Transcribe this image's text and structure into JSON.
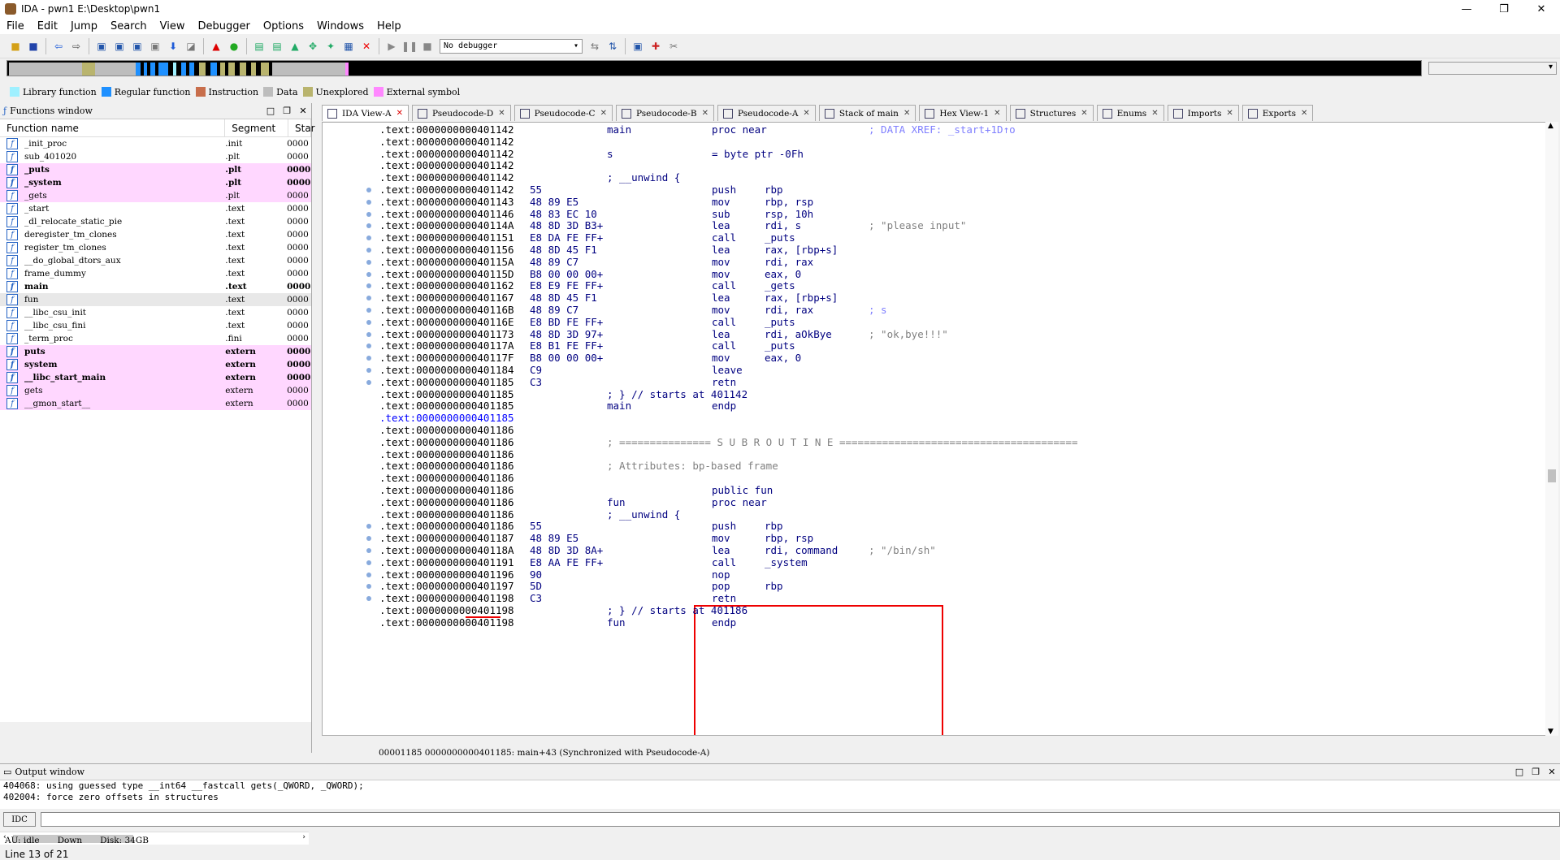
{
  "window": {
    "title": "IDA - pwn1 E:\\Desktop\\pwn1",
    "minimize": "—",
    "maximize": "❐",
    "close": "✕"
  },
  "menu": [
    "File",
    "Edit",
    "Jump",
    "Search",
    "View",
    "Debugger",
    "Options",
    "Windows",
    "Help"
  ],
  "toolbar": {
    "debugger_select": "No debugger"
  },
  "legend": [
    {
      "label": "Library function",
      "color": "#9ff0ff"
    },
    {
      "label": "Regular function",
      "color": "#1e90ff"
    },
    {
      "label": "Instruction",
      "color": "#c86e4b"
    },
    {
      "label": "Data",
      "color": "#bdbdbd"
    },
    {
      "label": "Unexplored",
      "color": "#b9b46e"
    },
    {
      "label": "External symbol",
      "color": "#ff88ff"
    }
  ],
  "functions_window": {
    "title": "Functions window",
    "columns": [
      "Function name",
      "Segment",
      "Star"
    ],
    "rows": [
      {
        "name": "_init_proc",
        "segment": ".init",
        "start": "0000",
        "style": ""
      },
      {
        "name": "sub_401020",
        "segment": ".plt",
        "start": "0000",
        "style": ""
      },
      {
        "name": "_puts",
        "segment": ".plt",
        "start": "0000",
        "style": "pink bold"
      },
      {
        "name": "_system",
        "segment": ".plt",
        "start": "0000",
        "style": "pink bold"
      },
      {
        "name": "_gets",
        "segment": ".plt",
        "start": "0000",
        "style": "pink"
      },
      {
        "name": "_start",
        "segment": ".text",
        "start": "0000",
        "style": ""
      },
      {
        "name": "_dl_relocate_static_pie",
        "segment": ".text",
        "start": "0000",
        "style": ""
      },
      {
        "name": "deregister_tm_clones",
        "segment": ".text",
        "start": "0000",
        "style": ""
      },
      {
        "name": "register_tm_clones",
        "segment": ".text",
        "start": "0000",
        "style": ""
      },
      {
        "name": "__do_global_dtors_aux",
        "segment": ".text",
        "start": "0000",
        "style": ""
      },
      {
        "name": "frame_dummy",
        "segment": ".text",
        "start": "0000",
        "style": ""
      },
      {
        "name": "main",
        "segment": ".text",
        "start": "0000",
        "style": "bold"
      },
      {
        "name": "fun",
        "segment": ".text",
        "start": "0000",
        "style": "sel"
      },
      {
        "name": "__libc_csu_init",
        "segment": ".text",
        "start": "0000",
        "style": ""
      },
      {
        "name": "__libc_csu_fini",
        "segment": ".text",
        "start": "0000",
        "style": ""
      },
      {
        "name": "_term_proc",
        "segment": ".fini",
        "start": "0000",
        "style": ""
      },
      {
        "name": "puts",
        "segment": "extern",
        "start": "0000",
        "style": "pink bold"
      },
      {
        "name": "system",
        "segment": "extern",
        "start": "0000",
        "style": "pink bold"
      },
      {
        "name": "__libc_start_main",
        "segment": "extern",
        "start": "0000",
        "style": "pink bold"
      },
      {
        "name": "gets",
        "segment": "extern",
        "start": "0000",
        "style": "pink"
      },
      {
        "name": "__gmon_start__",
        "segment": "extern",
        "start": "0000",
        "style": "pink"
      }
    ],
    "line_info": "Line 13 of 21"
  },
  "tabs": [
    {
      "label": "IDA View-A",
      "active": true
    },
    {
      "label": "Pseudocode-D",
      "active": false
    },
    {
      "label": "Pseudocode-C",
      "active": false
    },
    {
      "label": "Pseudocode-B",
      "active": false
    },
    {
      "label": "Pseudocode-A",
      "active": false
    },
    {
      "label": "Stack of main",
      "active": false
    },
    {
      "label": "Hex View-1",
      "active": false
    },
    {
      "label": "Structures",
      "active": false
    },
    {
      "label": "Enums",
      "active": false
    },
    {
      "label": "Imports",
      "active": false
    },
    {
      "label": "Exports",
      "active": false
    }
  ],
  "disasm": [
    {
      "addr": ".text:0000000000401142",
      "bytes": "",
      "label": "main",
      "mn": "proc near",
      "op": "",
      "cm": "; DATA XREF: _start+1D↑o",
      "cmblue": true
    },
    {
      "addr": ".text:0000000000401142",
      "bytes": "",
      "label": "",
      "mn": "",
      "op": "",
      "cm": ""
    },
    {
      "addr": ".text:0000000000401142",
      "bytes": "",
      "label": "s",
      "mn": "= byte ptr -0Fh",
      "op": "",
      "cm": ""
    },
    {
      "addr": ".text:0000000000401142",
      "bytes": "",
      "label": "",
      "mn": "",
      "op": "",
      "cm": ""
    },
    {
      "addr": ".text:0000000000401142",
      "bytes": "",
      "label": "; __unwind {",
      "mn": "",
      "op": "",
      "cm": ""
    },
    {
      "addr": ".text:0000000000401142",
      "bytes": "55",
      "label": "",
      "mn": "push",
      "op": "rbp",
      "cm": "",
      "dot": true
    },
    {
      "addr": ".text:0000000000401143",
      "bytes": "48 89 E5",
      "label": "",
      "mn": "mov",
      "op": "rbp, rsp",
      "cm": "",
      "dot": true
    },
    {
      "addr": ".text:0000000000401146",
      "bytes": "48 83 EC 10",
      "label": "",
      "mn": "sub",
      "op": "rsp, 10h",
      "cm": "",
      "dot": true
    },
    {
      "addr": ".text:000000000040114A",
      "bytes": "48 8D 3D B3+",
      "label": "",
      "mn": "lea",
      "op": "rdi, s",
      "cm": "; \"please input\"",
      "dot": true
    },
    {
      "addr": ".text:0000000000401151",
      "bytes": "E8 DA FE FF+",
      "label": "",
      "mn": "call",
      "op": "_puts",
      "cm": "",
      "dot": true
    },
    {
      "addr": ".text:0000000000401156",
      "bytes": "48 8D 45 F1",
      "label": "",
      "mn": "lea",
      "op": "rax, [rbp+s]",
      "cm": "",
      "dot": true
    },
    {
      "addr": ".text:000000000040115A",
      "bytes": "48 89 C7",
      "label": "",
      "mn": "mov",
      "op": "rdi, rax",
      "cm": "",
      "dot": true
    },
    {
      "addr": ".text:000000000040115D",
      "bytes": "B8 00 00 00+",
      "label": "",
      "mn": "mov",
      "op": "eax, 0",
      "cm": "",
      "dot": true
    },
    {
      "addr": ".text:0000000000401162",
      "bytes": "E8 E9 FE FF+",
      "label": "",
      "mn": "call",
      "op": "_gets",
      "cm": "",
      "dot": true
    },
    {
      "addr": ".text:0000000000401167",
      "bytes": "48 8D 45 F1",
      "label": "",
      "mn": "lea",
      "op": "rax, [rbp+s]",
      "cm": "",
      "dot": true
    },
    {
      "addr": ".text:000000000040116B",
      "bytes": "48 89 C7",
      "label": "",
      "mn": "mov",
      "op": "rdi, rax",
      "cm": "; s",
      "dot": true,
      "cmblue": true
    },
    {
      "addr": ".text:000000000040116E",
      "bytes": "E8 BD FE FF+",
      "label": "",
      "mn": "call",
      "op": "_puts",
      "cm": "",
      "dot": true
    },
    {
      "addr": ".text:0000000000401173",
      "bytes": "48 8D 3D 97+",
      "label": "",
      "mn": "lea",
      "op": "rdi, aOkBye",
      "cm": "; \"ok,bye!!!\"",
      "dot": true
    },
    {
      "addr": ".text:000000000040117A",
      "bytes": "E8 B1 FE FF+",
      "label": "",
      "mn": "call",
      "op": "_puts",
      "cm": "",
      "dot": true
    },
    {
      "addr": ".text:000000000040117F",
      "bytes": "B8 00 00 00+",
      "label": "",
      "mn": "mov",
      "op": "eax, 0",
      "cm": "",
      "dot": true
    },
    {
      "addr": ".text:0000000000401184",
      "bytes": "C9",
      "label": "",
      "mn": "leave",
      "op": "",
      "cm": "",
      "dot": true
    },
    {
      "addr": ".text:0000000000401185",
      "bytes": "C3",
      "label": "",
      "mn": "retn",
      "op": "",
      "cm": "",
      "dot": true
    },
    {
      "addr": ".text:0000000000401185",
      "bytes": "",
      "label": "; } // starts at 401142",
      "mn": "",
      "op": "",
      "cm": ""
    },
    {
      "addr": ".text:0000000000401185",
      "bytes": "",
      "label": "main",
      "mn": "endp",
      "op": "",
      "cm": ""
    },
    {
      "addr": ".text:0000000000401185",
      "bytes": "",
      "label": "",
      "mn": "",
      "op": "",
      "cm": "",
      "blue": true
    },
    {
      "addr": ".text:0000000000401186",
      "bytes": "",
      "label": "",
      "mn": "",
      "op": "",
      "cm": ""
    },
    {
      "addr": ".text:0000000000401186",
      "bytes": "",
      "label": "; =============== S U B R O U T I N E =======================================",
      "mn": "",
      "op": "",
      "cm": "",
      "labgray": true
    },
    {
      "addr": ".text:0000000000401186",
      "bytes": "",
      "label": "",
      "mn": "",
      "op": "",
      "cm": ""
    },
    {
      "addr": ".text:0000000000401186",
      "bytes": "",
      "label": "; Attributes: bp-based frame",
      "mn": "",
      "op": "",
      "cm": "",
      "labgray": true
    },
    {
      "addr": ".text:0000000000401186",
      "bytes": "",
      "label": "",
      "mn": "",
      "op": "",
      "cm": ""
    },
    {
      "addr": ".text:0000000000401186",
      "bytes": "",
      "label": "",
      "mn": "public fun",
      "op": "",
      "cm": ""
    },
    {
      "addr": ".text:0000000000401186",
      "bytes": "",
      "label": "fun",
      "mn": "proc near",
      "op": "",
      "cm": ""
    },
    {
      "addr": ".text:0000000000401186",
      "bytes": "",
      "label": "; __unwind {",
      "mn": "",
      "op": "",
      "cm": ""
    },
    {
      "addr": ".text:0000000000401186",
      "bytes": "55",
      "label": "",
      "mn": "push",
      "op": "rbp",
      "cm": "",
      "dot": true
    },
    {
      "addr": ".text:0000000000401187",
      "bytes": "48 89 E5",
      "label": "",
      "mn": "mov",
      "op": "rbp, rsp",
      "cm": "",
      "dot": true
    },
    {
      "addr": ".text:000000000040118A",
      "bytes": "48 8D 3D 8A+",
      "label": "",
      "mn": "lea",
      "op": "rdi, command",
      "cm": "; \"/bin/sh\"",
      "dot": true
    },
    {
      "addr": ".text:0000000000401191",
      "bytes": "E8 AA FE FF+",
      "label": "",
      "mn": "call",
      "op": "_system",
      "cm": "",
      "dot": true
    },
    {
      "addr": ".text:0000000000401196",
      "bytes": "90",
      "label": "",
      "mn": "nop",
      "op": "",
      "cm": "",
      "dot": true
    },
    {
      "addr": ".text:0000000000401197",
      "bytes": "5D",
      "label": "",
      "mn": "pop",
      "op": "rbp",
      "cm": "",
      "dot": true
    },
    {
      "addr": ".text:0000000000401198",
      "bytes": "C3",
      "label": "",
      "mn": "retn",
      "op": "",
      "cm": "",
      "dot": true
    },
    {
      "addr": ".text:0000000000401198",
      "bytes": "",
      "label": "; } // starts at 401186",
      "mn": "",
      "op": "",
      "cm": ""
    },
    {
      "addr": ".text:0000000000401198",
      "bytes": "",
      "label": "fun",
      "mn": "endp",
      "op": "",
      "cm": ""
    }
  ],
  "status_line": "00001185 0000000000401185: main+43 (Synchronized with Pseudocode-A)",
  "output_window": {
    "title": "Output window",
    "lines": [
      "404068: using guessed type __int64 __fastcall gets(_QWORD, _QWORD);",
      "402004: force zero offsets in structures"
    ]
  },
  "idc": {
    "button": "IDC"
  },
  "statusbar": {
    "state": "AU:  idle",
    "direction": "Down",
    "disk": "Disk: 34GB"
  }
}
